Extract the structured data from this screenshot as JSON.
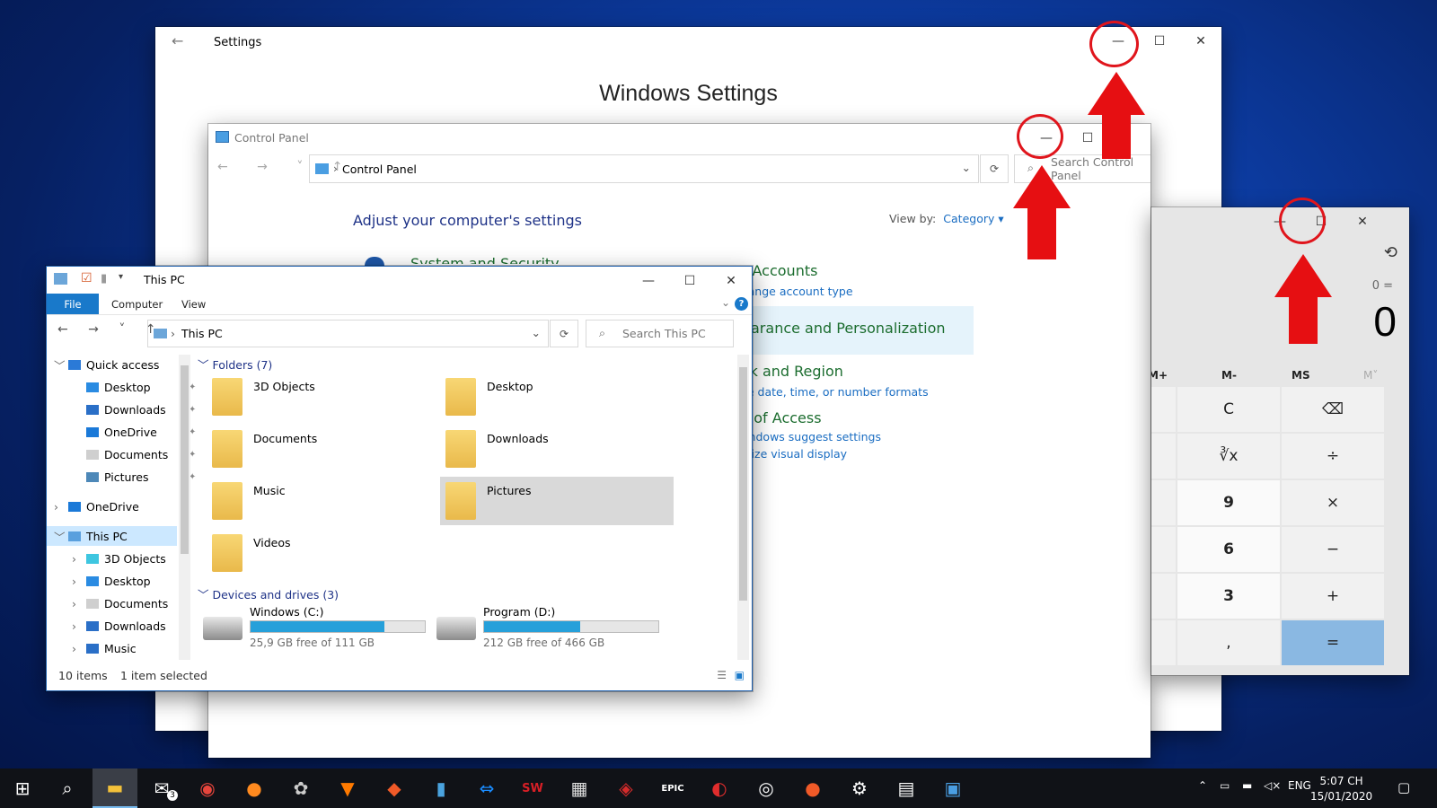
{
  "settings": {
    "title": "Settings",
    "heading": "Windows Settings"
  },
  "control_panel": {
    "title": "Control Panel",
    "address": "Control Panel",
    "search_placeholder": "Search Control Panel",
    "adjust": "Adjust your computer's settings",
    "view_by_label": "View by:",
    "view_by_value": "Category ▾",
    "partial_system": "System and Security",
    "user_accounts": "er Accounts",
    "change_account": "Change account type",
    "appearance": "pearance and Personalization",
    "clock_region": "ock and Region",
    "clock_sub": "nge date, time, or number formats",
    "ease": "se of Access",
    "ease_sub1": "Windows suggest settings",
    "ease_sub2": "timize visual display"
  },
  "calculator": {
    "expression": "0 =",
    "display": "0",
    "memory": [
      "M+",
      "M-",
      "MS",
      "M˅"
    ],
    "keys": [
      [
        "",
        "C",
        "⌫"
      ],
      [
        "",
        "∛x",
        "÷"
      ],
      [
        "",
        "9",
        "×"
      ],
      [
        "",
        "6",
        "−"
      ],
      [
        "",
        "3",
        "+"
      ],
      [
        "",
        ",",
        "="
      ]
    ]
  },
  "explorer": {
    "title": "This PC",
    "file_tab": "File",
    "tabs": [
      "Computer",
      "View"
    ],
    "address": "This PC",
    "search_placeholder": "Search This PC",
    "tree": [
      {
        "label": "Quick access",
        "level": 0,
        "exp": "﹀",
        "color": "#2b7ad7"
      },
      {
        "label": "Desktop",
        "level": 1,
        "pin": true,
        "color": "#2a8be2"
      },
      {
        "label": "Downloads",
        "level": 1,
        "pin": true,
        "color": "#2a6fc7"
      },
      {
        "label": "OneDrive",
        "level": 1,
        "pin": true,
        "color": "#1a79d8"
      },
      {
        "label": "Documents",
        "level": 1,
        "pin": true,
        "color": "#cfcfcf"
      },
      {
        "label": "Pictures",
        "level": 1,
        "pin": true,
        "color": "#4d88b8"
      },
      {
        "label": "OneDrive",
        "level": 0,
        "exp": "›",
        "color": "#1a79d8"
      },
      {
        "label": "This PC",
        "level": 0,
        "exp": "﹀",
        "color": "#5aa0de",
        "sel": true
      },
      {
        "label": "3D Objects",
        "level": 1,
        "exp": "›",
        "color": "#3ec6e0"
      },
      {
        "label": "Desktop",
        "level": 1,
        "exp": "›",
        "color": "#2a8be2"
      },
      {
        "label": "Documents",
        "level": 1,
        "exp": "›",
        "color": "#cfcfcf"
      },
      {
        "label": "Downloads",
        "level": 1,
        "exp": "›",
        "color": "#2a6fc7"
      },
      {
        "label": "Music",
        "level": 1,
        "exp": "›",
        "color": "#2a6fc7"
      }
    ],
    "folders_header": "Folders (7)",
    "folders": [
      "3D Objects",
      "Desktop",
      "Documents",
      "Downloads",
      "Music",
      "Pictures",
      "Videos"
    ],
    "selected_folder": "Pictures",
    "drives_header": "Devices and drives (3)",
    "drives": [
      {
        "name": "Windows (C:)",
        "free": "25,9 GB free of 111 GB",
        "used": 0.77
      },
      {
        "name": "Program (D:)",
        "free": "212 GB free of 466 GB",
        "used": 0.55
      }
    ],
    "status_items": "10 items",
    "status_selected": "1 item selected"
  },
  "taskbar": {
    "lang": "ENG",
    "time": "5:07 CH",
    "date": "15/01/2020",
    "mail_badge": "3"
  }
}
